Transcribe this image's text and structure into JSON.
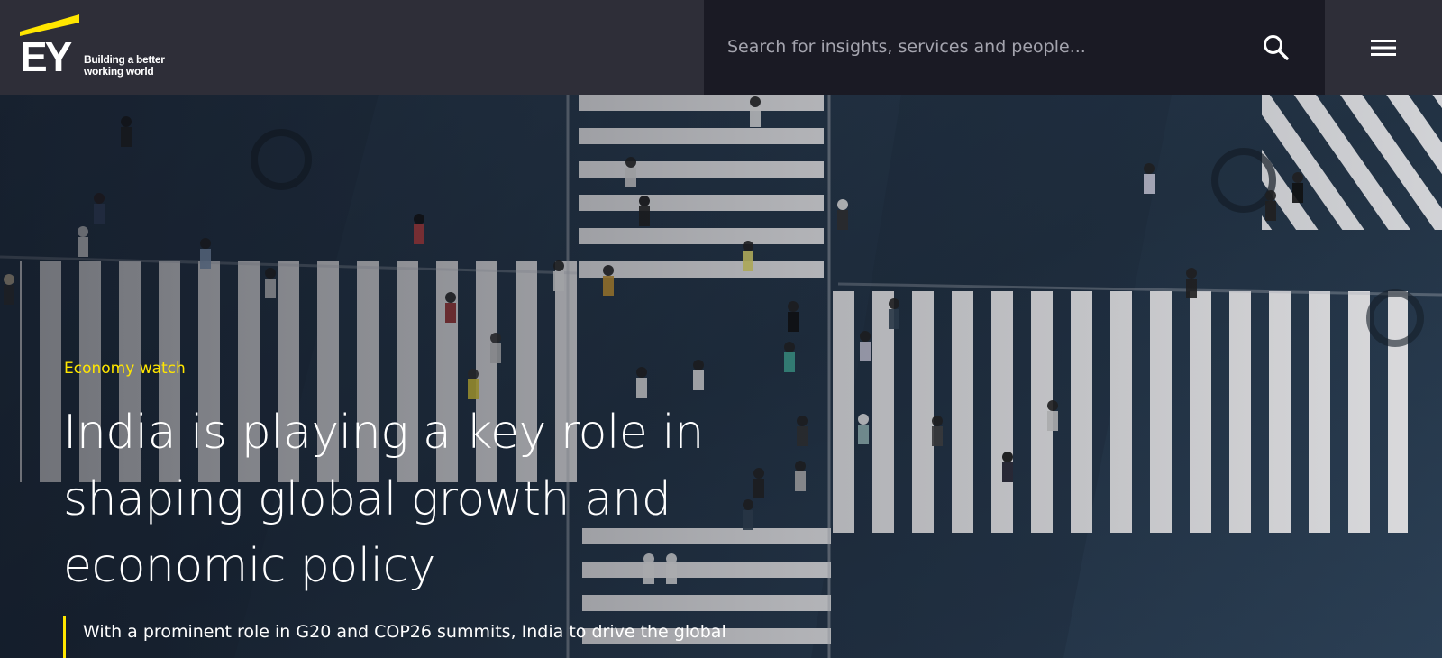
{
  "brand": {
    "logo_text": "EY",
    "tagline": "Building a better working world",
    "accent_color": "#ffe600"
  },
  "search": {
    "placeholder": "Search for insights, services and people...",
    "icon": "search-icon"
  },
  "menu": {
    "icon": "hamburger-menu-icon"
  },
  "hero": {
    "eyebrow": "Economy watch",
    "headline": "India is playing a key role in shaping global growth and economic policy",
    "summary": "With a prominent role in G20 and COP26 summits, India to drive the global"
  }
}
